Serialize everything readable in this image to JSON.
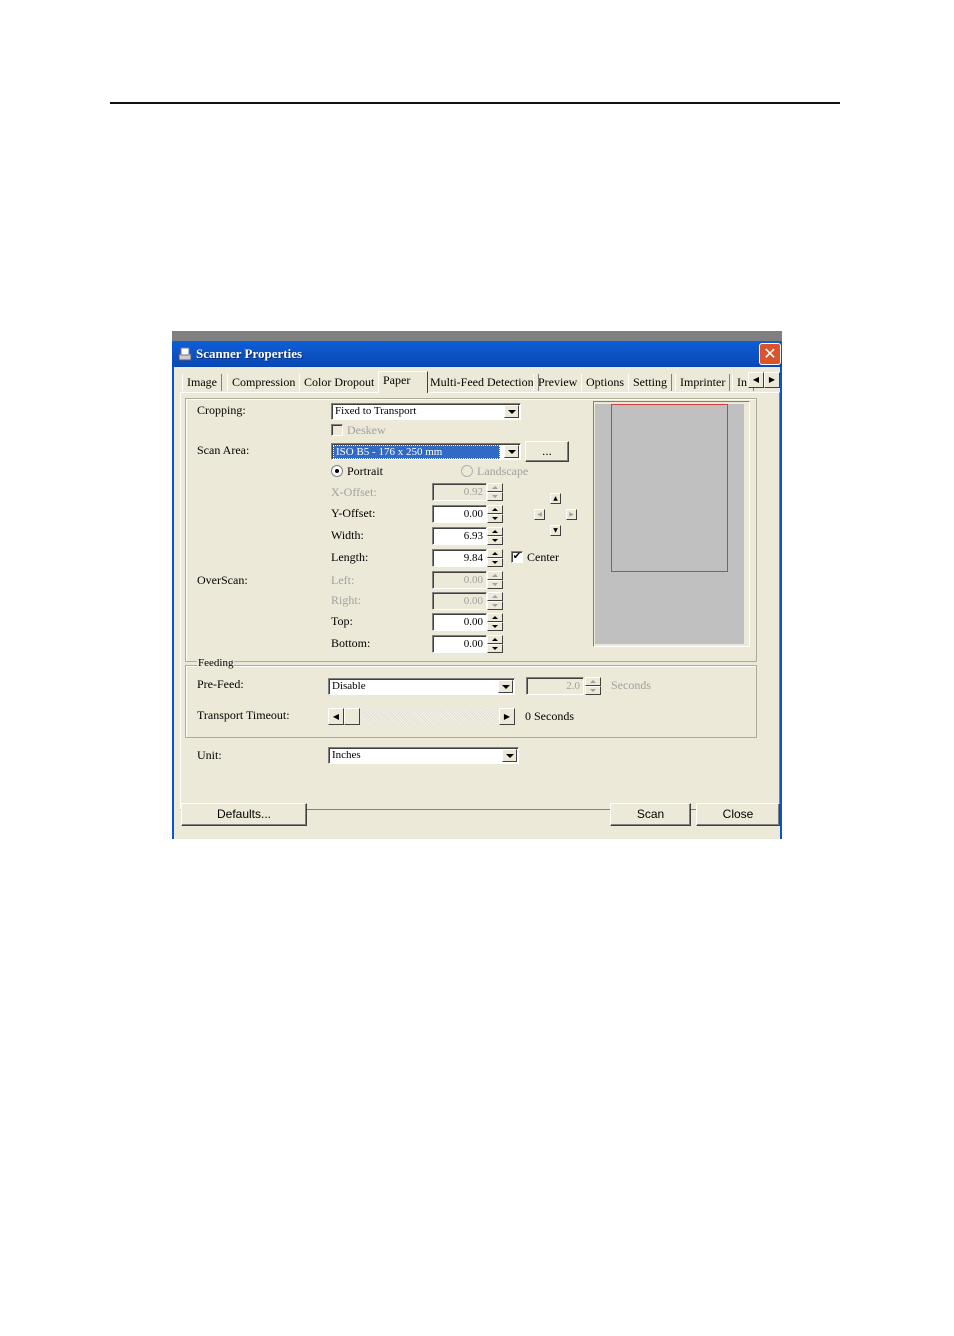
{
  "window": {
    "title": "Scanner Properties",
    "close_glyph": "✕"
  },
  "tabs": [
    {
      "label": "Image"
    },
    {
      "label": "Compression"
    },
    {
      "label": "Color Dropout"
    },
    {
      "label": "Paper",
      "active": true
    },
    {
      "label": "Multi-Feed Detection"
    },
    {
      "label": "Preview"
    },
    {
      "label": "Options"
    },
    {
      "label": "Setting"
    },
    {
      "label": "Imprinter"
    },
    {
      "label": "In"
    }
  ],
  "tab_scroll": {
    "left": "◀",
    "right": "▶"
  },
  "paper": {
    "cropping_label": "Cropping:",
    "cropping_value": "Fixed to Transport",
    "deskew_label": "Deskew",
    "scan_area_label": "Scan Area:",
    "scan_area_value": "ISO B5 - 176 x 250 mm",
    "more_button": "...",
    "portrait_label": "Portrait",
    "landscape_label": "Landscape",
    "orientation": "Portrait",
    "x_offset_label": "X-Offset:",
    "x_offset_value": "0.92",
    "y_offset_label": "Y-Offset:",
    "y_offset_value": "0.00",
    "width_label": "Width:",
    "width_value": "6.93",
    "length_label": "Length:",
    "length_value": "9.84",
    "center_label": "Center",
    "center_checked": "✔",
    "overscan_label": "OverScan:",
    "left_label": "Left:",
    "left_value": "0.00",
    "right_label": "Right:",
    "right_value": "0.00",
    "top_label": "Top:",
    "top_value": "0.00",
    "bottom_label": "Bottom:",
    "bottom_value": "0.00"
  },
  "feeding": {
    "group_label": "Feeding",
    "prefeed_label": "Pre-Feed:",
    "prefeed_value": "Disable",
    "prefeed_seconds_value": "2.0",
    "seconds_label": "Seconds",
    "timeout_label": "Transport Timeout:",
    "timeout_value_text": "0 Seconds",
    "timeout_value": 0,
    "scroll_left": "◀",
    "scroll_right": "▶"
  },
  "unit": {
    "label": "Unit:",
    "value": "Inches"
  },
  "footer": {
    "defaults_button": "Defaults...",
    "scan_button": "Scan",
    "close_button": "Close"
  },
  "colors": {
    "titlebar": "#0c55c8",
    "dialog_bg": "#ece9d8",
    "selection": "#316ac5",
    "scan_area_outline": "#d04040",
    "preview_bg": "#c0c0c0"
  }
}
